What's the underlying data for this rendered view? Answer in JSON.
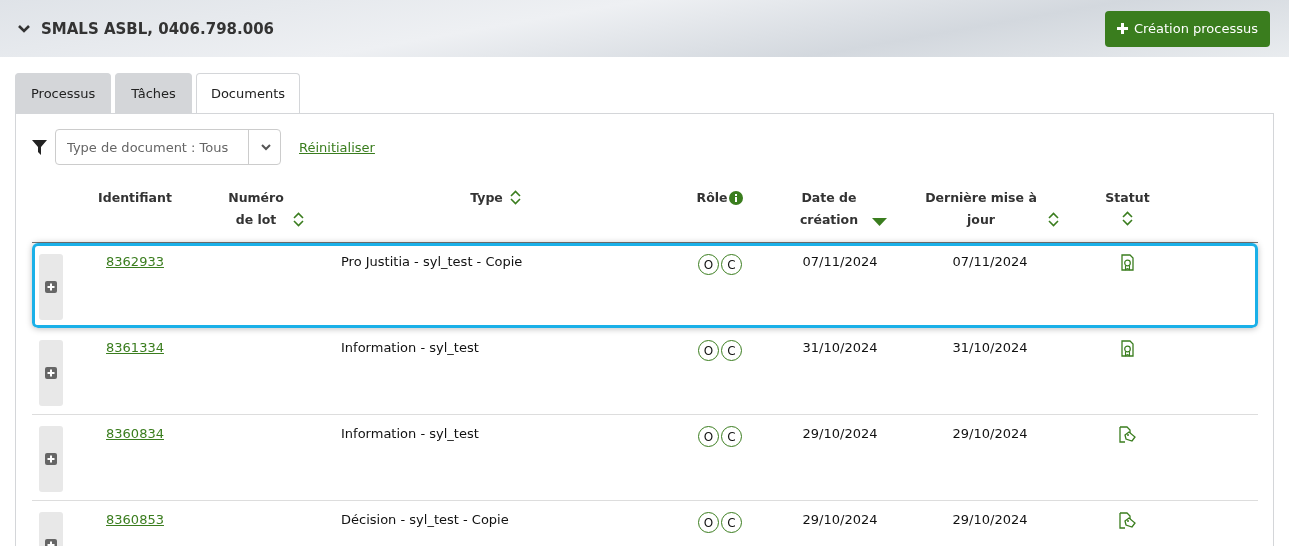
{
  "header": {
    "title": "SMALS ASBL, 0406.798.006",
    "expanded": true,
    "create_button": "Création processus"
  },
  "tabs": [
    {
      "label": "Processus",
      "selected": false
    },
    {
      "label": "Tâches",
      "selected": false
    },
    {
      "label": "Documents",
      "selected": true
    }
  ],
  "filter": {
    "placeholder": "Type de document : Tous",
    "reset_link": "Réinitialiser"
  },
  "table": {
    "columns": [
      {
        "label": "Identifiant"
      },
      {
        "label": "Numéro de lot",
        "sortable": true,
        "sorted_descending": false
      },
      {
        "label": "Type",
        "sortable": true,
        "sorted_descending": false
      },
      {
        "label": "Rôle",
        "info": true
      },
      {
        "label": "Date de création",
        "sortable": true,
        "sorted_descending": true
      },
      {
        "label": "Dernière mise à jour",
        "sortable": true,
        "sorted_descending": false
      },
      {
        "label": "Statut",
        "sortable": true,
        "sorted_descending": false
      }
    ],
    "rows": [
      {
        "selected": true,
        "id": "8362933",
        "type": "Pro Justitia - syl_test - Copie",
        "roles": [
          "O",
          "C"
        ],
        "created": "07/11/2024",
        "updated": "07/11/2024",
        "status": {
          "kind": "certified"
        }
      },
      {
        "selected": false,
        "id": "8361334",
        "type": "Information - syl_test",
        "roles": [
          "O",
          "C"
        ],
        "created": "31/10/2024",
        "updated": "31/10/2024",
        "status": {
          "kind": "certified"
        }
      },
      {
        "selected": false,
        "id": "8360834",
        "type": "Information - syl_test",
        "roles": [
          "O",
          "C"
        ],
        "created": "29/10/2024",
        "updated": "29/10/2024",
        "status": {
          "kind": "tagged"
        }
      },
      {
        "selected": false,
        "id": "8360853",
        "type": "Décision - syl_test - Copie",
        "roles": [
          "O",
          "C"
        ],
        "created": "29/10/2024",
        "updated": "29/10/2024",
        "status": {
          "kind": "tagged"
        }
      }
    ]
  }
}
